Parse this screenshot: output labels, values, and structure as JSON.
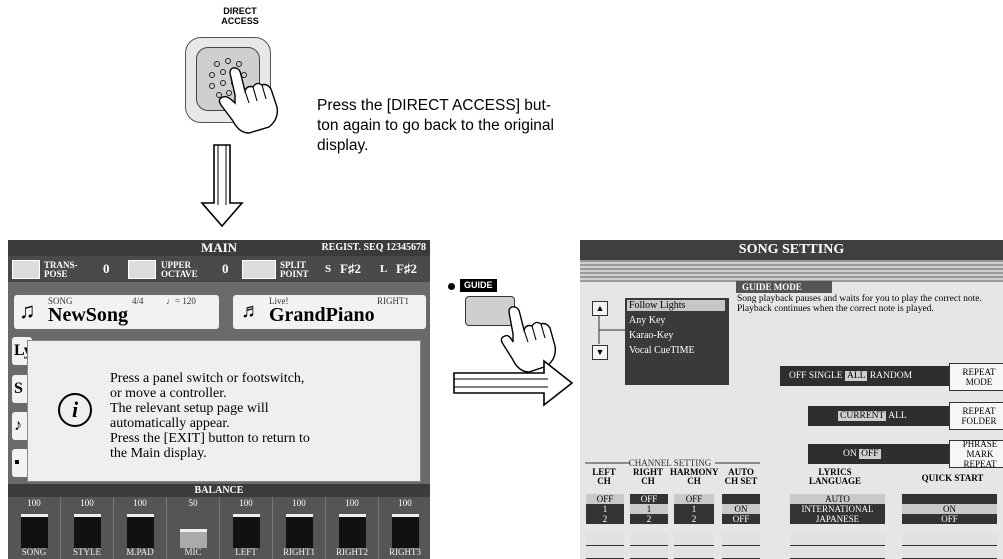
{
  "direct_access": {
    "label": "DIRECT\nACCESS",
    "instruction": "Press the [DIRECT ACCESS] but-\nton again to go back to the original\ndisplay."
  },
  "main": {
    "title": "MAIN",
    "regist": "REGIST. SEQ 12345678",
    "transpose_label": "TRANS-\nPOSE",
    "transpose_value": "0",
    "upper_octave_label": "UPPER\nOCTAVE",
    "upper_octave_value": "0",
    "split_point_label": "SPLIT\nPOINT",
    "split_s": "S",
    "split_s_value": "F♯2",
    "split_l": "L",
    "split_l_value": "F♯2",
    "song_small": "SONG",
    "song_time": "4/4",
    "song_tempo": "♩= 120",
    "song_name": "NewSong",
    "voice_small": "Live!",
    "voice_part": "RIGHT1",
    "voice_name": "GrandPiano",
    "dialog_lines": [
      "Press a panel switch or footswitch,",
      "or move a controller.",
      "The relevant setup page will",
      "automatically appear.",
      "Press the [EXIT] button to return to",
      "the Main display."
    ],
    "balance_label": "BALANCE",
    "channels": [
      {
        "value": "100",
        "name": "SONG"
      },
      {
        "value": "100",
        "name": "STYLE"
      },
      {
        "value": "100",
        "name": "M.PAD"
      },
      {
        "value": "50",
        "name": "MIC"
      },
      {
        "value": "100",
        "name": "LEFT"
      },
      {
        "value": "100",
        "name": "RIGHT1"
      },
      {
        "value": "100",
        "name": "RIGHT2"
      },
      {
        "value": "100",
        "name": "RIGHT3"
      }
    ]
  },
  "guide": {
    "label": "GUIDE"
  },
  "song_setting": {
    "title": "SONG SETTING",
    "guide_mode_label": "GUIDE MODE",
    "guide_modes": [
      "Follow Lights",
      "Any Key",
      "Karao-Key",
      "Vocal CueTIME"
    ],
    "guide_desc": "Song playback pauses and waits for you to play the correct note. Playback continues when the correct note is played.",
    "repeat_mode_options": [
      "OFF",
      "SINGLE",
      "ALL",
      "RANDOM"
    ],
    "repeat_mode_selected": "ALL",
    "repeat_mode_button": "REPEAT\nMODE",
    "repeat_folder_options": [
      "CURRENT",
      "ALL"
    ],
    "repeat_folder_selected": "CURRENT",
    "repeat_folder_button": "REPEAT\nFOLDER",
    "phrase_options": [
      "ON",
      "OFF"
    ],
    "phrase_selected": "OFF",
    "phrase_button": "PHRASE MARK\nREPEAT",
    "channel_setting_label": "CHANNEL SETTING",
    "columns": {
      "left_ch": {
        "header": "LEFT\nCH",
        "values": [
          "OFF",
          "1",
          "2"
        ],
        "selected": "OFF"
      },
      "right_ch": {
        "header": "RIGHT\nCH",
        "values": [
          "OFF",
          "1",
          "2"
        ],
        "selected": "1"
      },
      "harmony_ch": {
        "header": "HARMONY\nCH",
        "values": [
          "OFF",
          "1",
          "2"
        ],
        "selected": "OFF"
      },
      "auto_ch_set": {
        "header": "AUTO\nCH SET",
        "values": [
          "ON",
          "OFF"
        ],
        "selected": "ON"
      },
      "lyrics_language": {
        "header": "LYRICS\nLANGUAGE",
        "values": [
          "AUTO",
          "INTERNATIONAL",
          "JAPANESE"
        ],
        "selected": "AUTO"
      },
      "quick_start": {
        "header": "QUICK START",
        "values": [
          "ON",
          "OFF"
        ],
        "selected": "ON"
      }
    }
  }
}
